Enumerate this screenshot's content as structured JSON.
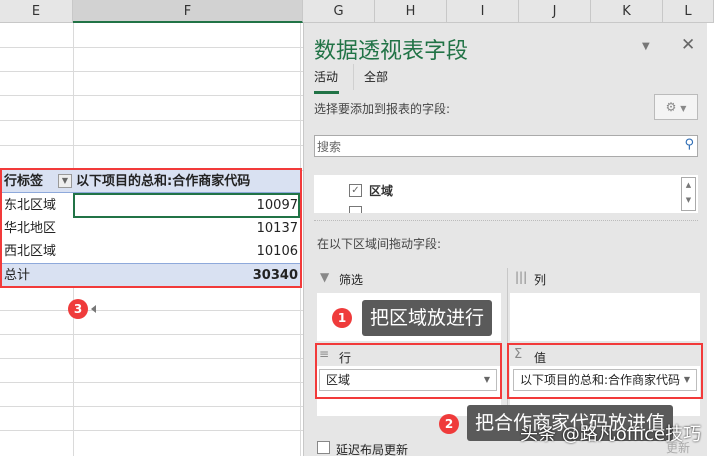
{
  "columns": [
    "E",
    "F",
    "G",
    "H",
    "I",
    "J",
    "K",
    "L"
  ],
  "pivot": {
    "header_row_label": "行标签",
    "header_value_label": "以下项目的总和:合作商家代码",
    "rows": [
      {
        "label": "东北区域",
        "value": "10097"
      },
      {
        "label": "华北地区",
        "value": "10137"
      },
      {
        "label": "西北区域",
        "value": "10106"
      }
    ],
    "total": {
      "label": "总计",
      "value": "30340"
    }
  },
  "panel": {
    "title": "数据透视表字段",
    "tabs": [
      "活动",
      "全部"
    ],
    "choose_label": "选择要添加到报表的字段:",
    "search_placeholder": "搜索",
    "fields": [
      {
        "label": "区域",
        "checked": true
      }
    ],
    "drag_label": "在以下区域间拖动字段:",
    "areas": {
      "filter": "筛选",
      "columns": "列",
      "rows": "行",
      "values": "值"
    },
    "rows_field": "区域",
    "values_field": "以下项目的总和:合作商家代码",
    "defer_label": "延迟布局更新",
    "update_button": "更新"
  },
  "annotations": [
    {
      "num": "1",
      "text": "把区域放进行"
    },
    {
      "num": "2",
      "text": "把合作商家代码放进值"
    },
    {
      "num": "3"
    }
  ],
  "watermark": "头条 @路凡office技巧",
  "colors": {
    "accent": "#217346",
    "highlight": "#f23a3a",
    "pivot_header": "#d9e1f2"
  }
}
